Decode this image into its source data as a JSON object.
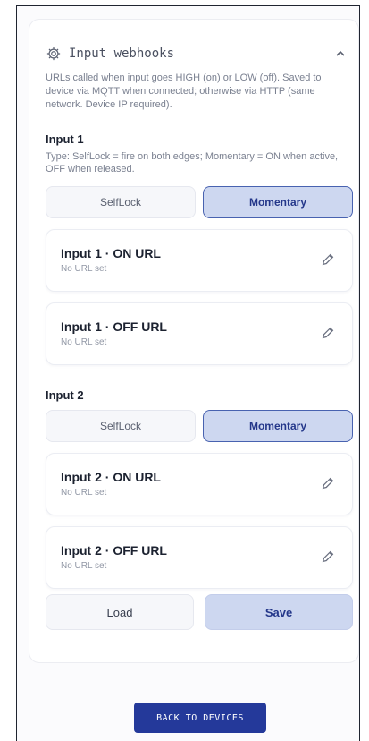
{
  "panel": {
    "title": "Input webhooks",
    "icon": "gear-icon",
    "collapse_icon": "chevron-up-icon",
    "description": "URLs called when input goes HIGH (on) or LOW (off). Saved to device via MQTT when connected; otherwise via HTTP (same network. Device IP required)."
  },
  "input1": {
    "title": "Input 1",
    "description": "Type: SelfLock = fire on both edges; Momentary = ON when active, OFF when released.",
    "modes": [
      "SelfLock",
      "Momentary"
    ],
    "selected_mode": "Momentary",
    "on": {
      "title": "Input 1 · ON URL",
      "value": "No URL set"
    },
    "off": {
      "title": "Input 1 · OFF URL",
      "value": "No URL set"
    }
  },
  "input2": {
    "title": "Input 2",
    "modes": [
      "SelfLock",
      "Momentary"
    ],
    "selected_mode": "Momentary",
    "on": {
      "title": "Input 2 · ON URL",
      "value": "No URL set"
    },
    "off": {
      "title": "Input 2 · OFF URL",
      "value": "No URL set"
    }
  },
  "actions": {
    "load": "Load",
    "save": "Save"
  },
  "footer": {
    "back": "BACK TO DEVICES"
  },
  "colors": {
    "accent": "#24399a",
    "selected_bg": "#cdd7f0",
    "selected_border": "#4862b0"
  }
}
